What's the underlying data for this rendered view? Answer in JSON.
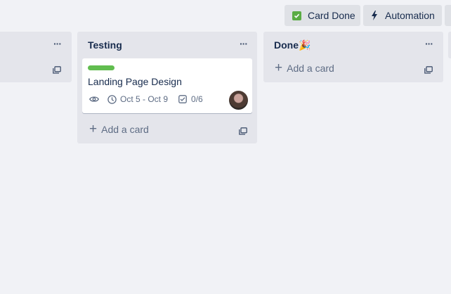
{
  "header": {
    "card_done_label": "Card Done",
    "automation_label": "Automation",
    "card_done_icon": "green-check-icon",
    "automation_icon": "lightning-icon"
  },
  "lists": [
    {
      "name": "left-partial-list",
      "title": "",
      "menu": "···"
    },
    {
      "name": "testing",
      "title": "Testing",
      "menu": "···",
      "add_card": "Add a card",
      "cards": [
        {
          "label_color": "#61bd4f",
          "title": "Landing Page Design",
          "due": "Oct 5 - Oct 9",
          "checklist": "0/6"
        }
      ]
    },
    {
      "name": "done",
      "title": "Done🎉",
      "menu": "···",
      "add_card": "Add a card"
    }
  ],
  "colors": {
    "board_bg": "#f1f2f6",
    "list_bg": "#e4e5eb",
    "label_green": "#61bd4f"
  }
}
